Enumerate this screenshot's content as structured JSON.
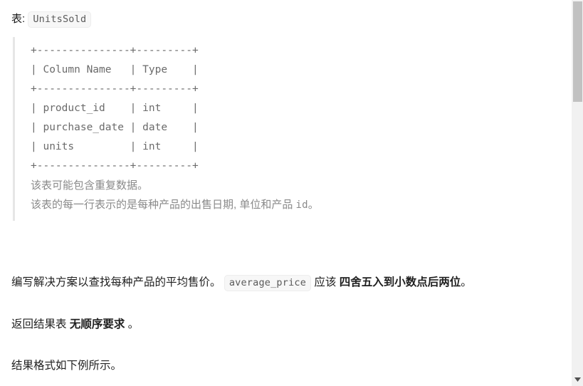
{
  "page": {
    "table_label_prefix": "表:",
    "table_name": "UnitsSold"
  },
  "schema_block": {
    "ascii_table": "+---------------+---------+\n| Column Name   | Type    |\n+---------------+---------+\n| product_id    | int     |\n| purchase_date | date    |\n| units         | int     |\n+---------------+---------+",
    "columns": [
      {
        "name": "product_id",
        "type": "int"
      },
      {
        "name": "purchase_date",
        "type": "date"
      },
      {
        "name": "units",
        "type": "int"
      }
    ],
    "headers": [
      "Column Name",
      "Type"
    ],
    "note_line_1": "该表可能包含重复数据。",
    "note_line_2_a": "该表的每一行表示的是每种产品的出售日期, 单位和产品 ",
    "note_line_2_code": "id",
    "note_line_2_b": "。"
  },
  "body": {
    "task_p1_a": "编写解决方案以查找每种产品的平均售价。 ",
    "task_p1_code": "average_price",
    "task_p1_b": " 应该 ",
    "task_p1_bold": "四舍五入到小数点后两位",
    "task_p1_c": "。",
    "order_a": "返回结果表 ",
    "order_bold": "无顺序要求",
    "order_b": " 。",
    "format_note": "结果格式如下例所示。"
  },
  "scrollbar": {
    "down_arrow_icon": "chevron-down-icon",
    "thumb_position_percent": 0,
    "thumb_size_percent": 26
  },
  "colors": {
    "text": "#1f1f1f",
    "muted": "#8a8a8a",
    "code_text": "#5a5a5a",
    "code_bg": "#f7f7f7",
    "quote_border": "#e6e6e6",
    "scrollbar_track": "#f1f1f1",
    "scrollbar_thumb": "#c1c1c1"
  }
}
